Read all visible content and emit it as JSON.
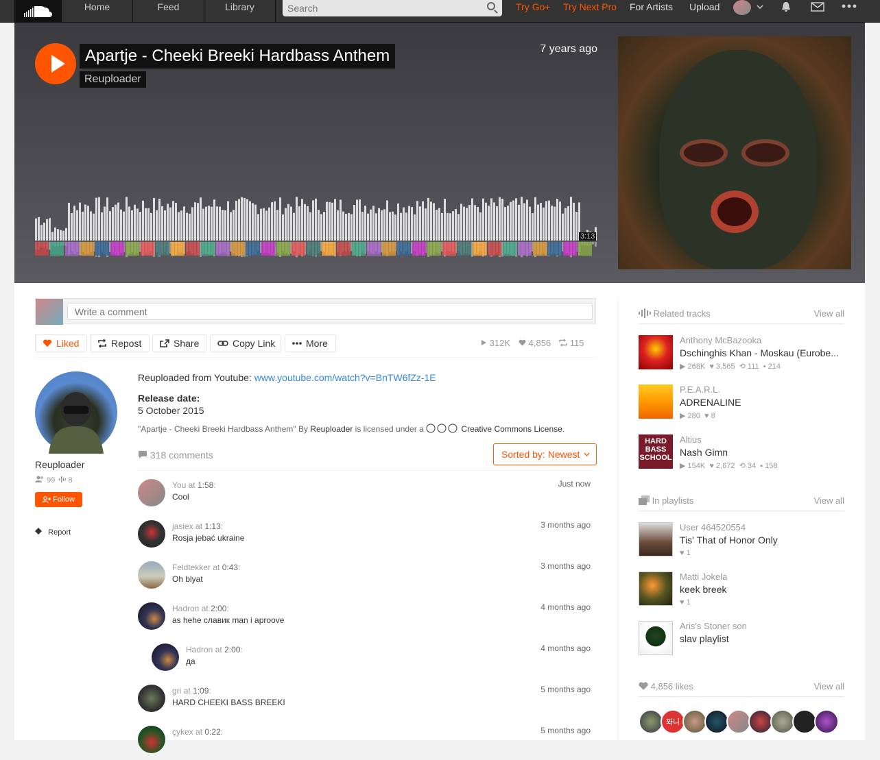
{
  "nav": {
    "home": "Home",
    "feed": "Feed",
    "library": "Library",
    "search_placeholder": "Search",
    "try_go": "Try Go+",
    "try_next_pro": "Try Next Pro",
    "for_artists": "For Artists",
    "upload": "Upload"
  },
  "colors": {
    "accent": "#ff5500",
    "link": "#3388dd"
  },
  "track": {
    "title": "Apartje - Cheeki Breeki Hardbass Anthem",
    "artist": "Reuploader",
    "posted": "7 years ago",
    "duration": "3:13"
  },
  "comment_input": {
    "placeholder": "Write a comment"
  },
  "actions": {
    "liked": "Liked",
    "repost": "Repost",
    "share": "Share",
    "copy_link": "Copy Link",
    "more": "More"
  },
  "stats": {
    "plays": "312K",
    "likes": "4,856",
    "reposts": "115"
  },
  "uploader": {
    "name": "Reuploader",
    "followers": "99",
    "tracks": "8",
    "follow": "Follow",
    "report": "Report"
  },
  "description": {
    "line1_prefix": "Reuploaded from Youtube: ",
    "line1_link": "www.youtube.com/watch?v=BnTW6fZz-1E",
    "release_label": "Release date:",
    "release_value": "5 October 2015",
    "license_prefix": "\"Apartje - Cheeki Breeki Hardbass Anthem\" By ",
    "license_user": "Reuploader",
    "license_mid": " is licensed under a ",
    "license_name": "Creative Commons License",
    "license_end": "."
  },
  "comments_header": {
    "count": "318 comments",
    "sort": "Sorted by: Newest"
  },
  "comments": [
    {
      "user": "You",
      "at": "at",
      "time": "1:58",
      "text": "Cool",
      "ago": "Just now"
    },
    {
      "user": "jasiex",
      "at": "at",
      "time": "1:13",
      "text": "Rosja jebać ukraine",
      "ago": "3 months ago"
    },
    {
      "user": "Feldtekker",
      "at": "at",
      "time": "0:43",
      "text": "Oh blyat",
      "ago": "3 months ago"
    },
    {
      "user": "Hadron",
      "at": "at",
      "time": "2:00",
      "text": "as hehe славик man i aproove",
      "ago": "4 months ago"
    },
    {
      "user": "Hadron",
      "at": "at",
      "time": "2:00",
      "text": "да",
      "ago": "4 months ago"
    },
    {
      "user": "gri",
      "at": "at",
      "time": "1:09",
      "text": "HARD CHEEKI BASS BREEKI",
      "ago": "5 months ago"
    },
    {
      "user": "çykex",
      "at": "at",
      "time": "0:22",
      "text": "",
      "ago": "5 months ago"
    }
  ],
  "related": {
    "header": "Related tracks",
    "view_all": "View all",
    "items": [
      {
        "artist": "Anthony McBazooka",
        "title": "Dschinghis Khan - Moskau (Eurobe...",
        "plays": "268K",
        "likes": "3,565",
        "reposts": "111",
        "comments": "214"
      },
      {
        "artist": "P.E.A.R.L.",
        "title": "ADRENALINE",
        "plays": "280",
        "likes": "8"
      },
      {
        "artist": "Altius",
        "title": "Nash Gimn",
        "plays": "154K",
        "likes": "2,672",
        "reposts": "34",
        "comments": "158"
      }
    ]
  },
  "playlists": {
    "header": "In playlists",
    "view_all": "View all",
    "items": [
      {
        "user": "User 464520554",
        "title": "Tis' That of Honor Only",
        "likes": "1"
      },
      {
        "user": "Matti Jokela",
        "title": "keek breek",
        "likes": "1"
      },
      {
        "user": "Aris's Stoner son",
        "title": "slav playlist"
      }
    ]
  },
  "likes_section": {
    "header": "4,856 likes",
    "view_all": "View all",
    "liker_text": "퐈니"
  }
}
